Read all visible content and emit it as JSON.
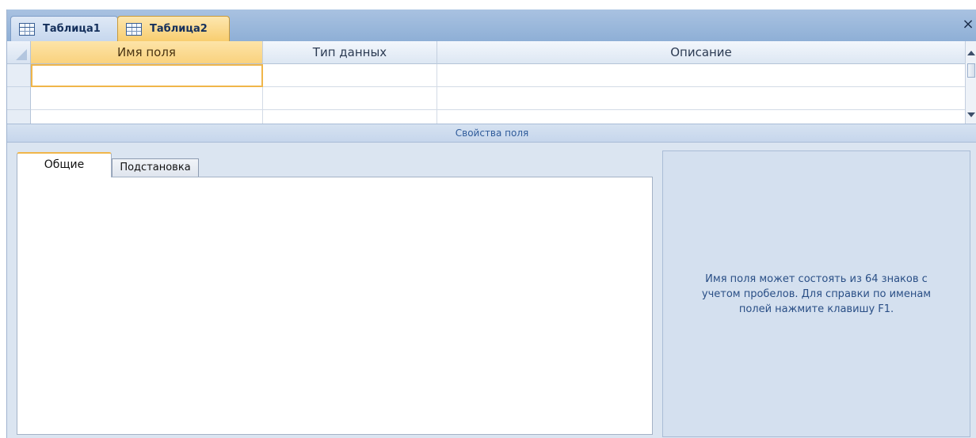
{
  "doc_tabs": [
    {
      "label": "Таблица1",
      "icon": "table-icon",
      "active": false
    },
    {
      "label": "Таблица2",
      "icon": "table-icon",
      "active": true
    }
  ],
  "close_glyph": "×",
  "grid": {
    "columns": [
      "Имя поля",
      "Тип данных",
      "Описание"
    ],
    "rows": [
      {
        "field_name": "",
        "data_type": "",
        "description": ""
      },
      {
        "field_name": "",
        "data_type": "",
        "description": ""
      },
      {
        "field_name": "",
        "data_type": "",
        "description": ""
      }
    ]
  },
  "section_title": "Свойства поля",
  "property_tabs": [
    "Общие",
    "Подстановка"
  ],
  "help_text": "Имя поля может состоять из 64 знаков с\nучетом пробелов.  Для справки по именам\nполей нажмите клавишу F1.",
  "colors": {
    "active_accent": "#f0b64a",
    "tab_bar": "#8eafd6",
    "pane_background": "#dbe5f1",
    "help_text": "#2a4f86"
  }
}
